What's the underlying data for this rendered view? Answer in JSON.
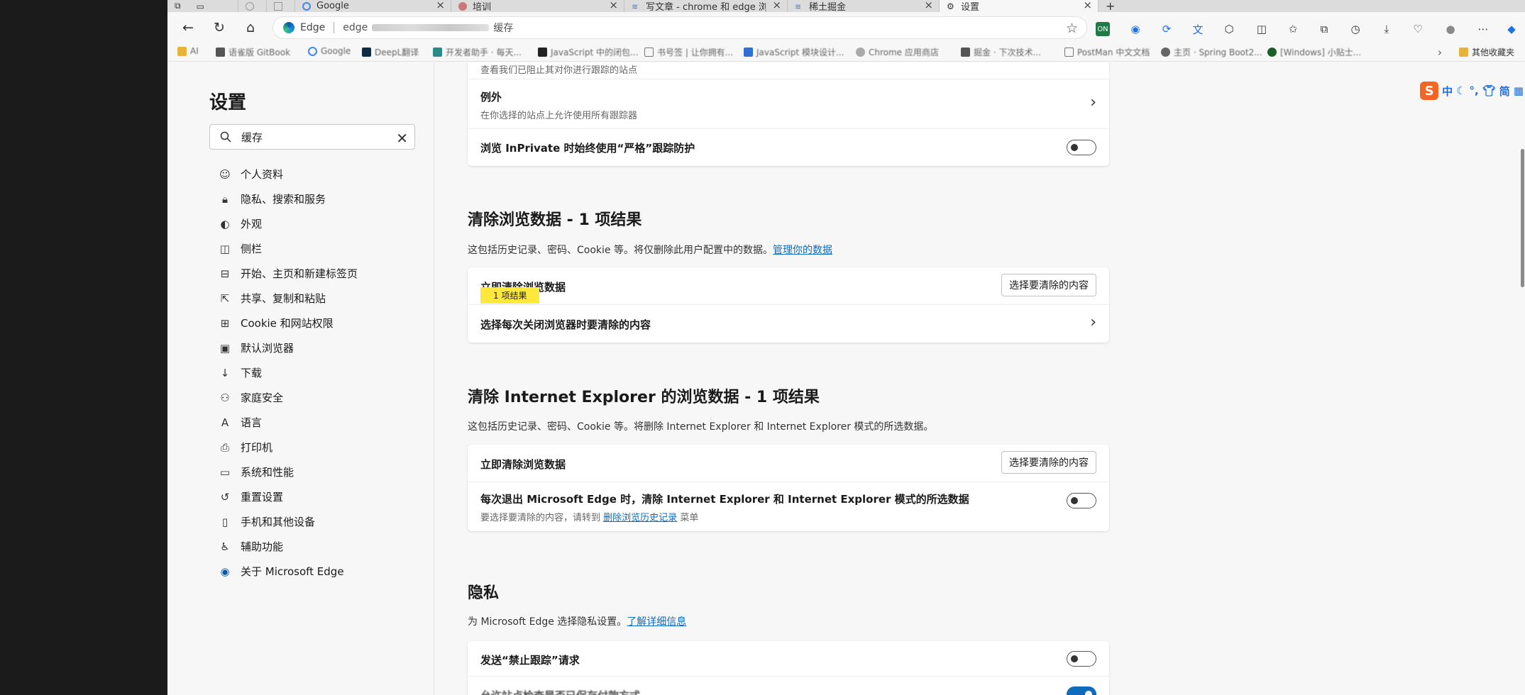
{
  "tabs": [
    {
      "label": "Google"
    },
    {
      "label": "培训"
    },
    {
      "label": "写文章 - chrome 和 edge 浏览器"
    },
    {
      "label": "稀土掘金"
    },
    {
      "label": "设置"
    }
  ],
  "address_bar": {
    "site_label": "Edge",
    "url_prefix": "edge",
    "url_suffix": "缓存"
  },
  "favorites": [
    {
      "label": "AI"
    },
    {
      "label": "语雀版 GitBook"
    },
    {
      "label": "Google"
    },
    {
      "label": "DeepL翻译"
    },
    {
      "label": "开发者助手 · 每天..."
    },
    {
      "label": "JavaScript 中的闭包..."
    },
    {
      "label": "书号签 | 让你拥有..."
    },
    {
      "label": "JavaScript 模块设计..."
    },
    {
      "label": "Chrome 应用商店"
    },
    {
      "label": "掘金 · 下次技术..."
    },
    {
      "label": "PostMan 中文文档"
    },
    {
      "label": "主页 · Spring Boot2..."
    },
    {
      "label": "[Windows] 小贴士..."
    }
  ],
  "favorites_overflow_label": "其他收藏夹",
  "sidebar": {
    "title": "设置",
    "search_value": "缓存",
    "items": [
      {
        "label": "个人资料",
        "icon": "profile-icon"
      },
      {
        "label": "隐私、搜索和服务",
        "icon": "lock-icon"
      },
      {
        "label": "外观",
        "icon": "appearance-icon"
      },
      {
        "label": "侧栏",
        "icon": "sidebar-icon"
      },
      {
        "label": "开始、主页和新建标签页",
        "icon": "home-icon"
      },
      {
        "label": "共享、复制和粘贴",
        "icon": "share-icon"
      },
      {
        "label": "Cookie 和网站权限",
        "icon": "permissions-icon"
      },
      {
        "label": "默认浏览器",
        "icon": "browser-icon"
      },
      {
        "label": "下载",
        "icon": "download-icon"
      },
      {
        "label": "家庭安全",
        "icon": "family-icon"
      },
      {
        "label": "语言",
        "icon": "language-icon"
      },
      {
        "label": "打印机",
        "icon": "printer-icon"
      },
      {
        "label": "系统和性能",
        "icon": "system-icon"
      },
      {
        "label": "重置设置",
        "icon": "reset-icon"
      },
      {
        "label": "手机和其他设备",
        "icon": "phone-icon"
      },
      {
        "label": "辅助功能",
        "icon": "accessibility-icon"
      },
      {
        "label": "关于 Microsoft Edge",
        "icon": "edge-icon"
      }
    ]
  },
  "tracking": {
    "partial_sub": "查看我们已阻止其对你进行跟踪的站点",
    "exceptions_title": "例外",
    "exceptions_sub": "在你选择的站点上允许使用所有跟踪器",
    "inprivate_label": "浏览 InPrivate 时始终使用“严格”跟踪防护"
  },
  "clear_data": {
    "heading": "清除浏览数据 - 1 项结果",
    "desc": "这包括历史记录、密码、Cookie 等。将仅删除此用户配置中的数据。",
    "desc_link": "管理你的数据",
    "now_label": "立即清除浏览数据",
    "match_badge": "1 项结果",
    "choose_button": "选择要清除的内容",
    "on_close_label": "选择每次关闭浏览器时要清除的内容"
  },
  "ie_data": {
    "heading": "清除 Internet Explorer 的浏览数据 - 1 项结果",
    "desc": "这包括历史记录、密码、Cookie 等。将删除 Internet Explorer 和 Internet Explorer 模式的所选数据。",
    "now_label": "立即清除浏览数据",
    "choose_button": "选择要清除的内容",
    "on_exit_label": "每次退出 Microsoft Edge 时，清除 Internet Explorer 和 Internet Explorer 模式的所选数据",
    "on_exit_sub_prefix": "要选择要清除的内容，请转到",
    "on_exit_sub_link": "删除浏览历史记录",
    "on_exit_sub_suffix": "菜单"
  },
  "privacy": {
    "heading": "隐私",
    "desc": "为 Microsoft Edge 选择隐私设置。",
    "desc_link": "了解详细信息",
    "dnt_label": "发送“禁止跟踪”请求",
    "next_label": "允许站点检查是否已保存付款方式"
  },
  "ime": {
    "logo": "S",
    "glyph_1": "中",
    "glyph_2": "简"
  },
  "colors": {
    "accent": "#0f6cbd",
    "highlight": "#ffe83c"
  }
}
